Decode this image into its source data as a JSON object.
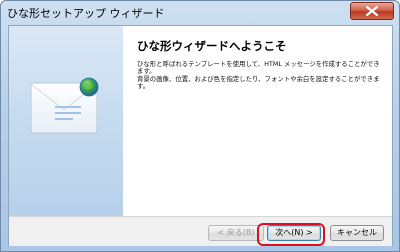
{
  "window": {
    "title": "ひな形セットアップ ウィザード"
  },
  "content": {
    "heading": "ひな形ウィザードへようこそ",
    "paragraph1": "ひな形と呼ばれるテンプレートを使用して、HTML メッセージを作成することができます。",
    "paragraph2": "背景の画像、位置、および色を指定したり、フォントや余白を設定することができます。"
  },
  "footer": {
    "back_label": "< 戻る(B)",
    "next_label": "次へ(N) >",
    "cancel_label": "キャンセル"
  },
  "colors": {
    "highlight": "#e00f1f",
    "title_gradient": "#b9d1ea",
    "close_red": "#c7432a"
  },
  "icons": [
    "close-icon",
    "envelope-icon"
  ]
}
